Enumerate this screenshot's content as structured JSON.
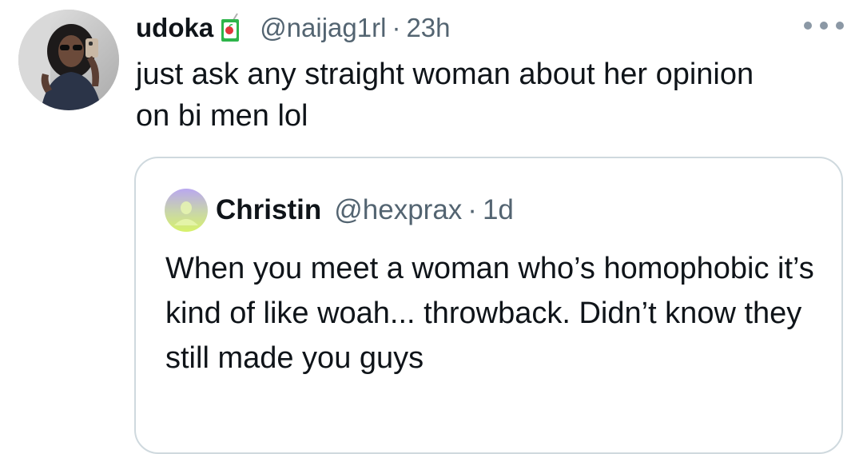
{
  "tweet": {
    "display_name": "udoka",
    "badge_icon": "juice-box-icon",
    "handle": "@naijag1rl",
    "separator": "·",
    "time": "23h",
    "more_icon": "more-options-icon",
    "text": "just ask any straight woman about her opinion\non bi men lol"
  },
  "quoted_tweet": {
    "display_name": "Christin",
    "handle": "@hexprax",
    "separator": "·",
    "time": "1d",
    "text": "When you meet a woman who’s homophobic it’s kind of like woah... throwback. Didn’t know they still made you guys"
  },
  "colors": {
    "text_primary": "#0f1419",
    "text_secondary": "#536471",
    "border": "#cfd9de",
    "juice_box_green": "#2db54a",
    "juice_box_red": "#e0353a",
    "quoted_avatar_purple": "#b9a7f0",
    "quoted_avatar_yellow": "#d7f26a"
  }
}
